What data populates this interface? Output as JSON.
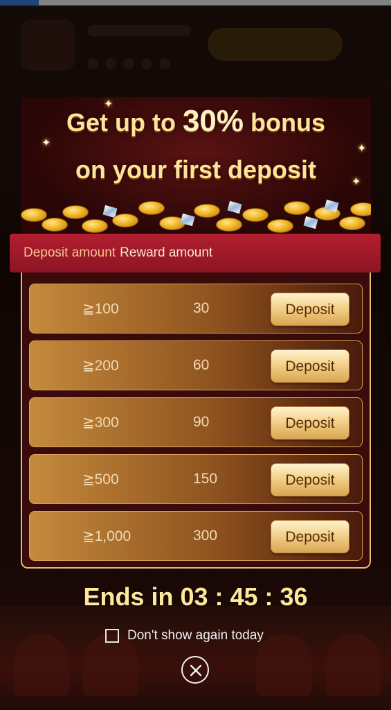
{
  "promo": {
    "title_line1_prefix": "Get up to",
    "title_line1_highlight": "30%",
    "title_line1_suffix": "bonus",
    "title_line2": "on your first deposit"
  },
  "table": {
    "header_deposit": "Deposit amount",
    "header_reward": "Reward amount",
    "rows": [
      {
        "threshold": "≧100",
        "reward": "30",
        "button": "Deposit"
      },
      {
        "threshold": "≧200",
        "reward": "60",
        "button": "Deposit"
      },
      {
        "threshold": "≧300",
        "reward": "90",
        "button": "Deposit"
      },
      {
        "threshold": "≧500",
        "reward": "150",
        "button": "Deposit"
      },
      {
        "threshold": "≧1,000",
        "reward": "300",
        "button": "Deposit"
      }
    ]
  },
  "countdown": {
    "label": "Ends in 03 : 45 : 36"
  },
  "footer": {
    "dont_show_label": "Don't show again today",
    "dont_show_checked": false
  },
  "icons": {
    "close": "close-circle-icon",
    "checkbox": "checkbox-icon"
  },
  "colors": {
    "accent_gold": "#ffe39a",
    "header_red": "#b21f2f",
    "button_gold": "#f3d18a"
  }
}
